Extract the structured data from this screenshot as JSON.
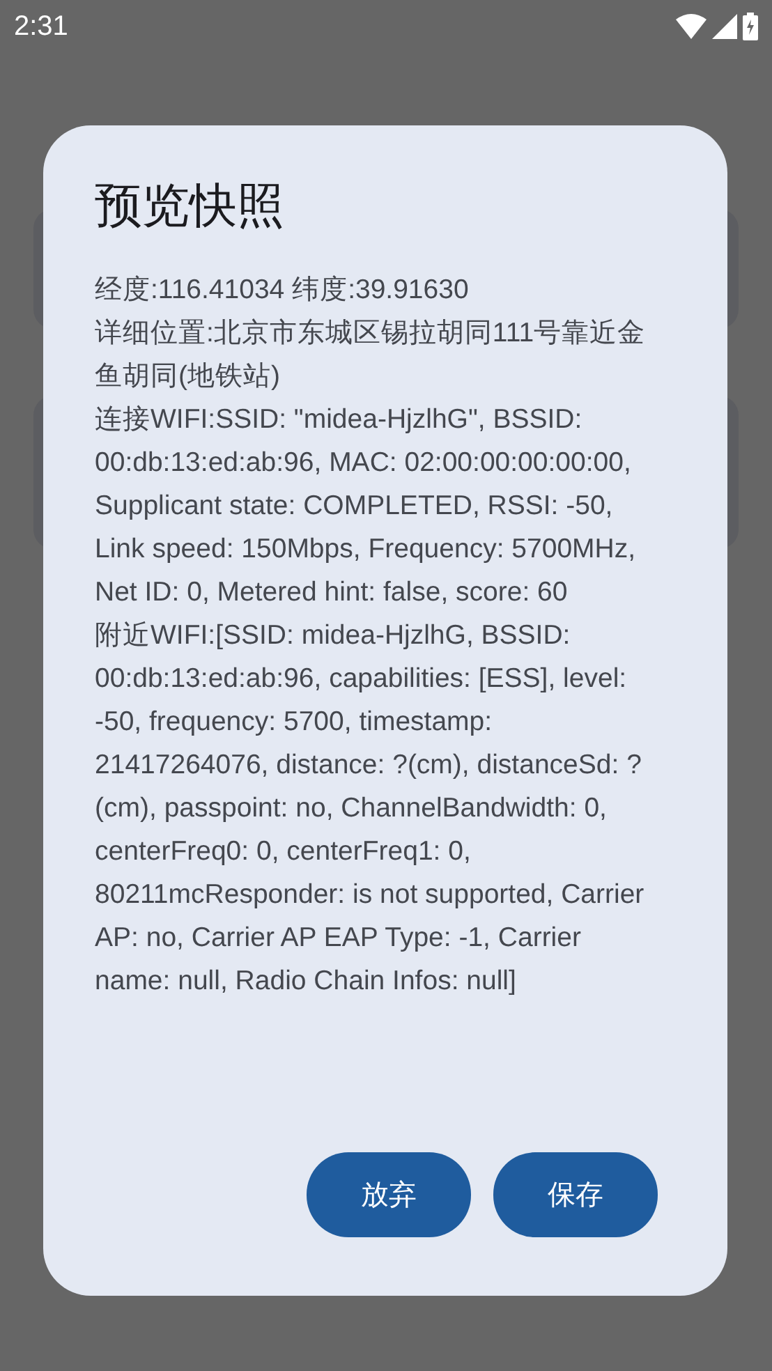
{
  "status_bar": {
    "time": "2:31"
  },
  "dialog": {
    "title": "预览快照",
    "paragraphs": [
      "经度:116.41034 纬度:39.91630",
      "详细位置:北京市东城区锡拉胡同111号靠近金鱼胡同(地铁站)",
      "连接WIFI:SSID: \"midea-HjzlhG\", BSSID: 00:db:13:ed:ab:96, MAC: 02:00:00:00:00:00, Supplicant state: COMPLETED, RSSI: -50, Link speed: 150Mbps, Frequency: 5700MHz, Net ID: 0, Metered hint: false, score: 60",
      "附近WIFI:[SSID: midea-HjzlhG, BSSID: 00:db:13:ed:ab:96, capabilities: [ESS], level: -50, frequency: 5700, timestamp: 21417264076, distance: ?(cm), distanceSd: ?(cm), passpoint: no, ChannelBandwidth: 0, centerFreq0: 0, centerFreq1: 0, 80211mcResponder: is not supported, Carrier AP: no, Carrier AP EAP Type: -1, Carrier name: null, Radio Chain Infos: null]"
    ],
    "buttons": [
      "放弃",
      "保存"
    ]
  }
}
